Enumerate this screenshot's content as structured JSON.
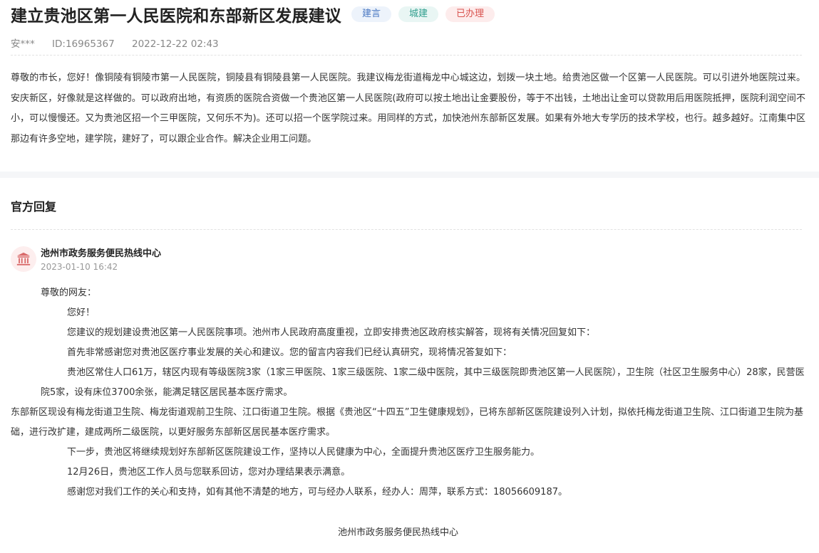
{
  "header": {
    "title": "建立贵池区第一人民医院和东部新区发展建议",
    "tags": [
      "建言",
      "城建",
      "已办理"
    ],
    "author": "安***",
    "id_text": "ID:16965367",
    "datetime": "2022-12-22 02:43"
  },
  "message": {
    "body": "尊敬的市长，您好！像铜陵有铜陵市第一人民医院，铜陵县有铜陵县第一人民医院。我建议梅龙街道梅龙中心城这边，划拨一块土地。给贵池区做一个区第一人民医院。可以引进外地医院过来。安庆新区，好像就是这样做的。可以政府出地，有资质的医院合资做一个贵池区第一人民医院(政府可以按土地出让金要股份，等于不出钱，土地出让金可以贷款用后用医院抵押，医院利润空间不小，可以慢慢还。又为贵池区招一个三甲医院，又何乐不为)。还可以招一个医学院过来。用同样的方式，加快池州东部新区发展。如果有外地大专学历的技术学校，也行。越多越好。江南集中区那边有许多空地，建学院，建好了，可以跟企业合作。解决企业用工问题。"
  },
  "reply": {
    "section_title": "官方回复",
    "org_name": "池州市政务服务便民热线中心",
    "time": "2023-01-10 16:42",
    "greeting": "尊敬的网友：",
    "paragraphs": [
      "您好！",
      "您建议的规划建设贵池区第一人民医院事项。池州市人民政府高度重视，立即安排贵池区政府核实解答，现将有关情况回复如下：",
      "首先非常感谢您对贵池区医疗事业发展的关心和建议。您的留言内容我们已经认真研究，现将情况答复如下：",
      "贵池区常住人口61万，辖区内现有等级医院3家（1家三甲医院、1家三级医院、1家二级中医院，其中三级医院即贵池区第一人民医院），卫生院（社区卫生服务中心）28家，民营医院5家，设有床位3700余张，能满足辖区居民基本医疗需求。"
    ],
    "paragraph_flush": "东部新区现设有梅龙街道卫生院、梅龙街道观前卫生院、江口街道卫生院。根据《贵池区“十四五”卫生健康规划》，已将东部新区医院建设列入计划，拟依托梅龙街道卫生院、江口街道卫生院为基础，进行改扩建，建成两所二级医院，以更好服务东部新区居民基本医疗需求。",
    "paragraphs_after": [
      "下一步，贵池区将继续规划好东部新区医院建设工作，坚持以人民健康为中心，全面提升贵池区医疗卫生服务能力。",
      "12月26日，贵池区工作人员与您联系回访，您对办理结果表示满意。",
      "感谢您对我们工作的关心和支持，如有其他不清楚的地方，可与经办人联系，经办人：周萍，联系方式：18056609187。"
    ],
    "signature": "池州市政务服务便民热线中心"
  },
  "colors": {
    "tag_blue": "#4a78c2",
    "tag_teal": "#2f9e8d",
    "tag_red": "#d9534f",
    "avatar_icon": "#d96a6a"
  },
  "icons": {
    "avatar": "government-building-icon"
  }
}
